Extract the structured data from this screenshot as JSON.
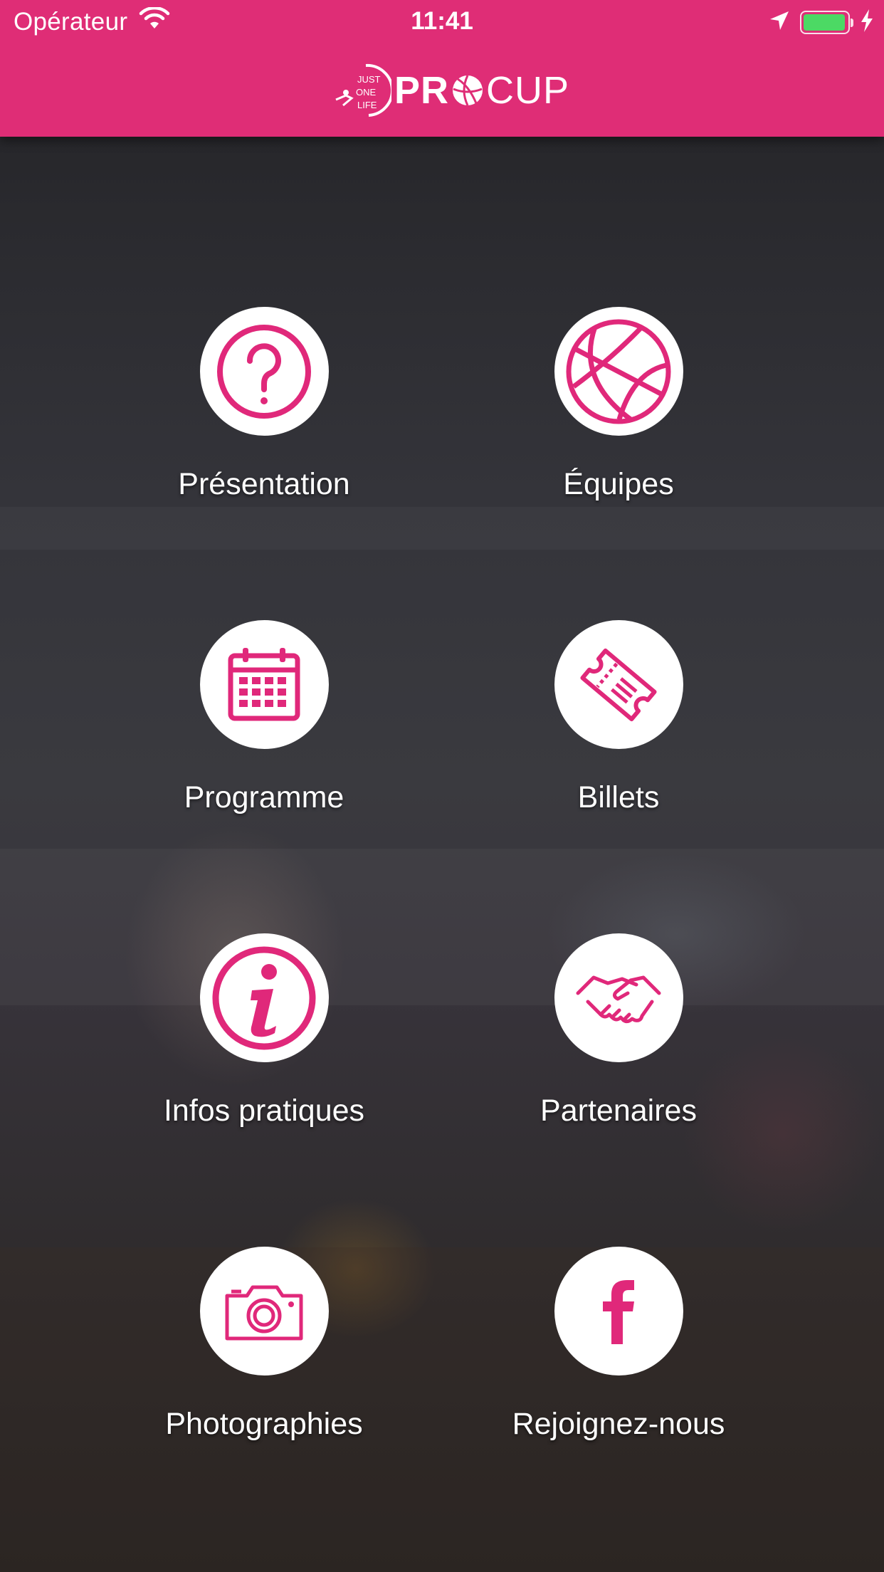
{
  "status_bar": {
    "carrier": "Opérateur",
    "time": "11:41",
    "battery_level": 1.0,
    "charging": true
  },
  "header": {
    "logo_text_bold": "PR",
    "logo_text_light": "CUP",
    "logo_emblem_lines": [
      "JUST",
      "ONE",
      "LIFE"
    ],
    "background_color": "#df2d76"
  },
  "accent_color": "#e0287a",
  "menu": [
    {
      "label": "Présentation",
      "icon": "question-icon"
    },
    {
      "label": "Équipes",
      "icon": "basketball-icon"
    },
    {
      "label": "Programme",
      "icon": "calendar-icon"
    },
    {
      "label": "Billets",
      "icon": "ticket-icon"
    },
    {
      "label": "Infos pratiques",
      "icon": "info-icon"
    },
    {
      "label": "Partenaires",
      "icon": "handshake-icon"
    },
    {
      "label": "Photographies",
      "icon": "camera-icon"
    },
    {
      "label": "Rejoignez-nous",
      "icon": "facebook-icon"
    }
  ]
}
